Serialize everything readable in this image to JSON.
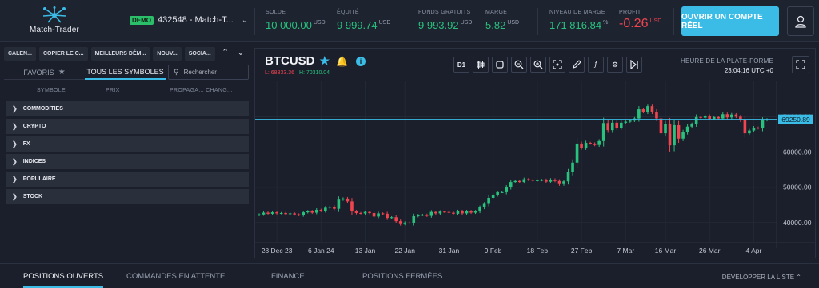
{
  "app": {
    "brand": "Match-Trader"
  },
  "account": {
    "badge": "DEMO",
    "label": "432548 - Match-T..."
  },
  "stats": [
    {
      "label": "SOLDE",
      "value": "10 000.00",
      "unit": "USD"
    },
    {
      "label": "ÉQUITÉ",
      "value": "9 999.74",
      "unit": "USD"
    },
    {
      "label": "FONDS GRATUITS",
      "value": "9 993.92",
      "unit": "USD"
    },
    {
      "label": "MARGE",
      "value": "5.82",
      "unit": "USD"
    },
    {
      "label": "NIVEAU DE MARGE",
      "value": "171 816.84",
      "unit": "%"
    },
    {
      "label": "PROFIT",
      "value": "-0.26",
      "unit": "USD"
    }
  ],
  "buttons": {
    "open_account": "OUVRIR UN COMPTE RÉEL"
  },
  "left": {
    "nav_tabs": [
      "CALEN...",
      "COPIER LE C...",
      "MEILLEURS DÉM...",
      "NOUV...",
      "SOCIA..."
    ],
    "sub_tabs": {
      "favorites": "FAVORIS",
      "all": "TOUS LES SYMBOLES"
    },
    "search_placeholder": "Rechercher",
    "columns": {
      "symbol": "SYMBOLE",
      "price": "PRIX",
      "spread": "PROPAGA... CHANG..."
    },
    "categories": [
      "COMMODITIES",
      "CRYPTO",
      "FX",
      "INDICES",
      "POPULAIRE",
      "STOCK"
    ]
  },
  "chart_header": {
    "symbol": "BTCUSD",
    "low_label": "L: 68833.36",
    "high_label": "H: 70310.04",
    "timeframe": "D1",
    "server_time_label": "HEURE DE LA PLATE-FORME",
    "server_time": "23:04:16 UTC +0"
  },
  "chart_data": {
    "type": "candlestick",
    "x_tick_labels": [
      "28 Dec 23",
      "6 Jan 24",
      "13 Jan",
      "22 Jan",
      "31 Jan",
      "9 Feb",
      "18 Feb",
      "27 Feb",
      "7 Mar",
      "16 Mar",
      "26 Mar",
      "4 Apr"
    ],
    "y_tick_labels": [
      "40000.00",
      "50000.00",
      "60000.00",
      "70000.00"
    ],
    "ylim": [
      35000,
      78000
    ],
    "current_price": 69250.89,
    "current_price_label": "69250.89",
    "colors": {
      "up": "#28c17d",
      "down": "#f0444f",
      "price_line": "#3bbce7"
    },
    "closes": [
      42300,
      42800,
      42500,
      42900,
      42600,
      42700,
      42400,
      42600,
      42300,
      42100,
      42900,
      43200,
      42800,
      43600,
      43300,
      44200,
      44500,
      43900,
      46500,
      46800,
      46000,
      43200,
      42700,
      42600,
      43000,
      42700,
      41700,
      42600,
      42500,
      41300,
      41500,
      40400,
      39600,
      40000,
      39900,
      41800,
      42100,
      42200,
      41900,
      43000,
      42600,
      43100,
      43000,
      42800,
      42500,
      43200,
      42600,
      43200,
      42800,
      43200,
      44300,
      45300,
      47000,
      47800,
      48600,
      48600,
      50000,
      51500,
      51800,
      51500,
      52300,
      52100,
      51900,
      52000,
      52100,
      51600,
      52200,
      51800,
      50900,
      51700,
      54300,
      57000,
      62400,
      61200,
      62600,
      62400,
      62000,
      63100,
      68200,
      66200,
      68300,
      66900,
      68300,
      68600,
      68900,
      69500,
      72100,
      71400,
      73000,
      71400,
      69500,
      65300,
      67900,
      61900,
      67600,
      63800,
      65600,
      67200,
      67900,
      69900,
      69700,
      70200,
      69400,
      69900,
      69500,
      70700,
      69800,
      70600,
      70000,
      69000,
      65300,
      66100,
      66900,
      66700,
      69000,
      69250
    ]
  },
  "bottom": {
    "tabs": [
      "POSITIONS OUVERTS",
      "COMMANDES EN ATTENTE",
      "FINANCE",
      "POSITIONS FERMÉES"
    ],
    "expand_list": "DÉVELOPPER LA LISTE"
  }
}
